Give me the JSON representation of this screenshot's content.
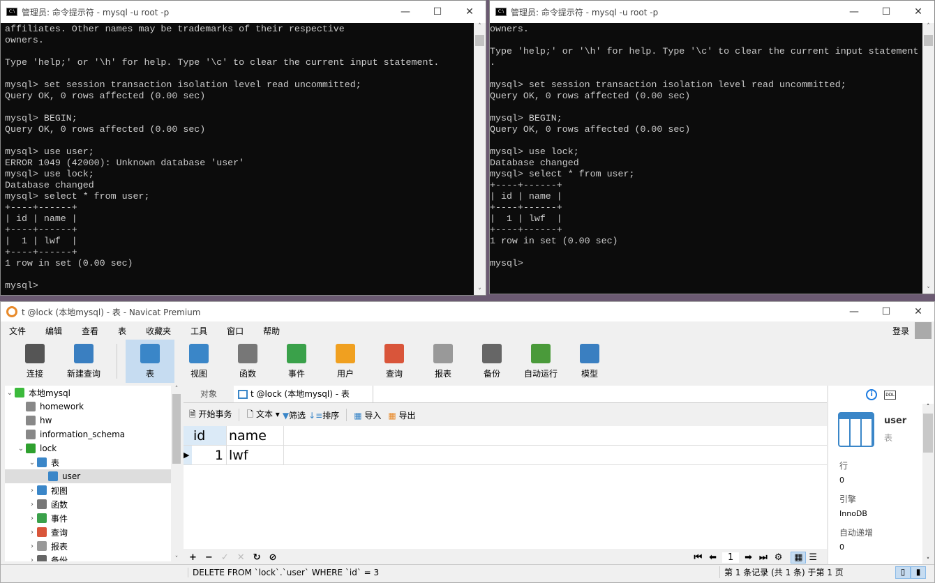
{
  "term_left": {
    "title": "管理员: 命令提示符 - mysql  -u root -p",
    "lines": [
      "affiliates. Other names may be trademarks of their respective",
      "owners.",
      "",
      "Type 'help;' or '\\h' for help. Type '\\c' to clear the current input statement.",
      "",
      "mysql> set session transaction isolation level read uncommitted;",
      "Query OK, 0 rows affected (0.00 sec)",
      "",
      "mysql> BEGIN;",
      "Query OK, 0 rows affected (0.00 sec)",
      "",
      "mysql> use user;",
      "ERROR 1049 (42000): Unknown database 'user'",
      "mysql> use lock;",
      "Database changed",
      "mysql> select * from user;",
      "+----+------+",
      "| id | name |",
      "+----+------+",
      "|  1 | lwf  |",
      "+----+------+",
      "1 row in set (0.00 sec)",
      "",
      "mysql>"
    ]
  },
  "term_right": {
    "title": "管理员: 命令提示符 - mysql  -u root -p",
    "lines": [
      "owners.",
      "",
      "Type 'help;' or '\\h' for help. Type '\\c' to clear the current input statement",
      ".",
      "",
      "mysql> set session transaction isolation level read uncommitted;",
      "Query OK, 0 rows affected (0.00 sec)",
      "",
      "mysql> BEGIN;",
      "Query OK, 0 rows affected (0.00 sec)",
      "",
      "mysql> use lock;",
      "Database changed",
      "mysql> select * from user;",
      "+----+------+",
      "| id | name |",
      "+----+------+",
      "|  1 | lwf  |",
      "+----+------+",
      "1 row in set (0.00 sec)",
      "",
      "mysql>"
    ]
  },
  "navicat": {
    "title": "t @lock (本地mysql) - 表 - Navicat Premium",
    "menu": [
      "文件",
      "编辑",
      "查看",
      "表",
      "收藏夹",
      "工具",
      "窗口",
      "帮助"
    ],
    "login": "登录",
    "toolbar": [
      {
        "label": "连接",
        "color": "#555"
      },
      {
        "label": "新建查询",
        "color": "#3a7fc1"
      },
      {
        "label": "表",
        "color": "#3a86c8",
        "active": true
      },
      {
        "label": "视图",
        "color": "#3a86c8"
      },
      {
        "label": "函数",
        "color": "#777"
      },
      {
        "label": "事件",
        "color": "#3aa14a"
      },
      {
        "label": "用户",
        "color": "#f0a020"
      },
      {
        "label": "查询",
        "color": "#d9553a"
      },
      {
        "label": "报表",
        "color": "#999"
      },
      {
        "label": "备份",
        "color": "#666"
      },
      {
        "label": "自动运行",
        "color": "#4a9a3a"
      },
      {
        "label": "模型",
        "color": "#3a7fc1"
      }
    ],
    "tree": [
      {
        "label": "本地mysql",
        "lvl": 0,
        "arrow": "v",
        "color": "#3cba3c"
      },
      {
        "label": "homework",
        "lvl": 1,
        "color": "#888"
      },
      {
        "label": "hw",
        "lvl": 1,
        "color": "#888"
      },
      {
        "label": "information_schema",
        "lvl": 1,
        "color": "#888"
      },
      {
        "label": "lock",
        "lvl": 1,
        "arrow": "v",
        "color": "#2ea02e"
      },
      {
        "label": "表",
        "lvl": 2,
        "arrow": "v",
        "color": "#3a86c8"
      },
      {
        "label": "user",
        "lvl": 3,
        "color": "#3a86c8",
        "sel": true
      },
      {
        "label": "视图",
        "lvl": 2,
        "arrow": ">",
        "color": "#3a86c8"
      },
      {
        "label": "函数",
        "lvl": 2,
        "arrow": ">",
        "color": "#777"
      },
      {
        "label": "事件",
        "lvl": 2,
        "arrow": ">",
        "color": "#3aa14a"
      },
      {
        "label": "查询",
        "lvl": 2,
        "arrow": ">",
        "color": "#d9553a"
      },
      {
        "label": "报表",
        "lvl": 2,
        "arrow": ">",
        "color": "#999"
      },
      {
        "label": "备份",
        "lvl": 2,
        "arrow": ">",
        "color": "#666"
      }
    ],
    "tabs": {
      "objects": "对象",
      "active": "t @lock (本地mysql) - 表"
    },
    "subtoolbar": {
      "begin": "开始事务",
      "text": "文本",
      "filter": "筛选",
      "sort": "排序",
      "import": "导入",
      "export": "导出"
    },
    "grid": {
      "columns": [
        "id",
        "name"
      ],
      "rows": [
        [
          "1",
          "lwf"
        ]
      ]
    },
    "pager": {
      "page": "1"
    },
    "status": {
      "sql": "DELETE FROM `lock`.`user` WHERE `id` = 3",
      "records": "第 1 条记录 (共 1 条) 于第 1 页"
    },
    "info": {
      "name": "user",
      "type": "表",
      "ddl": "DDL",
      "fields": [
        {
          "label": "行",
          "value": "0"
        },
        {
          "label": "引擎",
          "value": "InnoDB"
        },
        {
          "label": "自动递增",
          "value": "0"
        }
      ]
    }
  }
}
